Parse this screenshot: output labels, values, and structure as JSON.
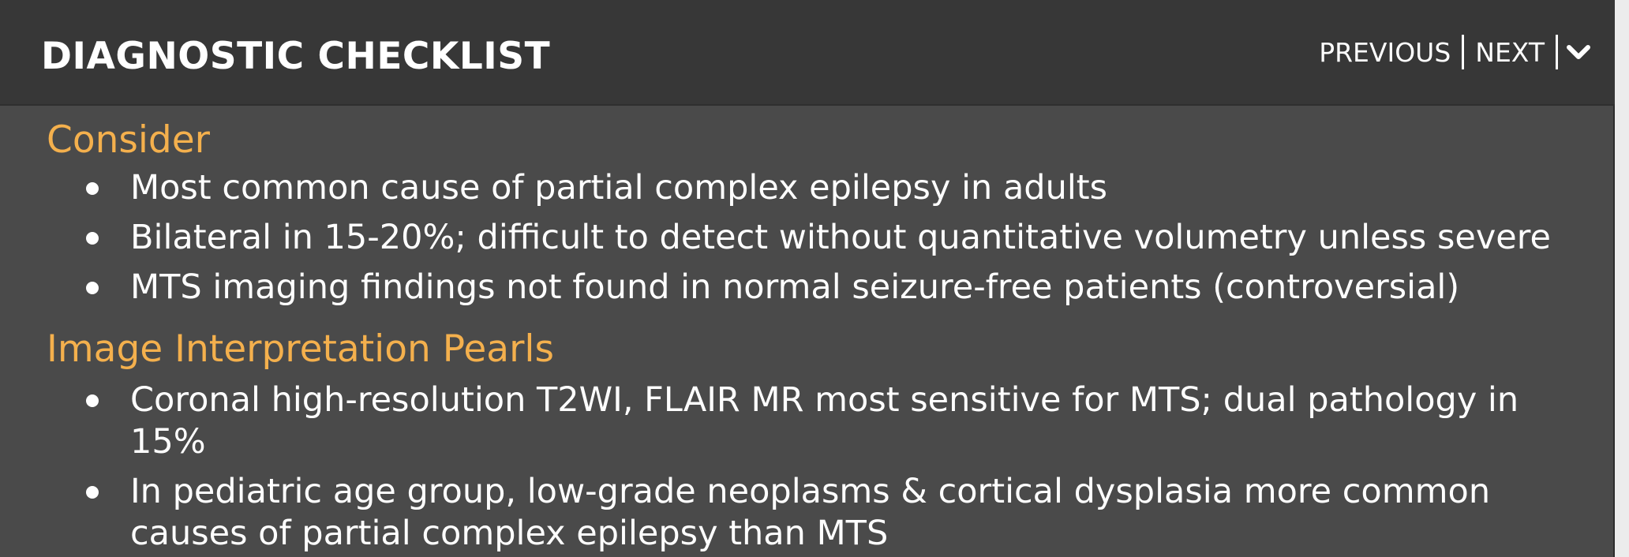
{
  "header": {
    "title": "DIAGNOSTIC CHECKLIST",
    "previous_label": "PREVIOUS",
    "next_label": "NEXT",
    "collapse_icon": "chevron-down-icon"
  },
  "sections": [
    {
      "heading": "Consider",
      "items": [
        "Most common cause of partial complex epilepsy in adults",
        "Bilateral in 15-20%; difficult to detect without quantitative volumetry unless severe",
        "MTS imaging findings not found in normal seizure-free patients (controversial)"
      ]
    },
    {
      "heading": "Image Interpretation Pearls",
      "items": [
        "Coronal high-resolution T2WI, FLAIR MR most sensitive for MTS; dual pathology in 15%",
        "In pediatric age group, low-grade neoplasms & cortical dysplasia more common causes of partial complex epilepsy than MTS"
      ]
    }
  ],
  "colors": {
    "panel_background": "#4a4a4a",
    "header_background": "#373737",
    "heading_accent": "#f4b04d",
    "text": "#ffffff"
  }
}
